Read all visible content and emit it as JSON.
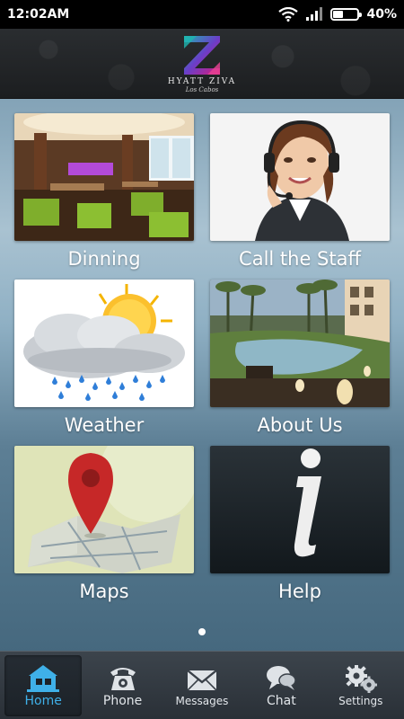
{
  "status_bar": {
    "time": "12:02AM",
    "battery": "40%",
    "battery_level": 0.4
  },
  "header": {
    "brand_name": "HYATT ZIVA",
    "brand_sub": "Los Cabos"
  },
  "tiles": [
    {
      "label": "Dinning",
      "icon": "restaurant-photo"
    },
    {
      "label": "Call the Staff",
      "icon": "headset-agent-photo"
    },
    {
      "label": "Weather",
      "icon": "sun-cloud-rain-icon"
    },
    {
      "label": "About Us",
      "icon": "resort-pool-photo"
    },
    {
      "label": "Maps",
      "icon": "map-pin-icon"
    },
    {
      "label": "Help",
      "icon": "info-icon"
    }
  ],
  "page_indicator": {
    "pages": 1,
    "current": 1
  },
  "bottom_nav": [
    {
      "label": "Home",
      "icon": "home-icon",
      "active": true
    },
    {
      "label": "Phone",
      "icon": "phone-icon",
      "active": false
    },
    {
      "label": "Messages",
      "icon": "envelope-icon",
      "active": false
    },
    {
      "label": "Chat",
      "icon": "chat-bubbles-icon",
      "active": false
    },
    {
      "label": "Settings",
      "icon": "gears-icon",
      "active": false
    }
  ],
  "colors": {
    "active_nav": "#3fb0e8",
    "logo_magenta": "#d81b7a",
    "logo_teal": "#1fb5b0"
  }
}
